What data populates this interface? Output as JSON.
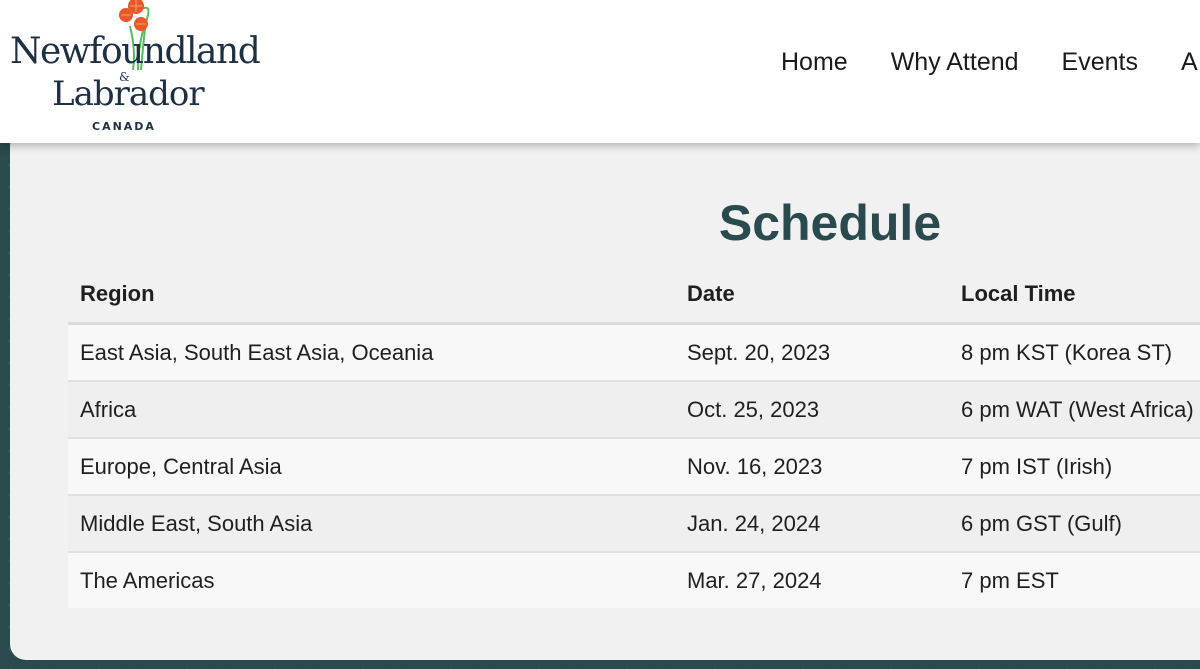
{
  "brand": {
    "logo_line1": "Newfoundland",
    "logo_amp": "&",
    "logo_line2": "Labrador",
    "logo_sub": "CANADA",
    "colors": {
      "primary": "#2b4a4d",
      "logo_text": "#1f2f42",
      "flower": "#e8582a",
      "stem": "#5cb85c"
    }
  },
  "nav": {
    "items": [
      {
        "label": "Home"
      },
      {
        "label": "Why Attend"
      },
      {
        "label": "Events"
      },
      {
        "label": "A"
      }
    ]
  },
  "main": {
    "title": "Schedule",
    "table": {
      "columns": [
        "Region",
        "Date",
        "Local Time"
      ],
      "rows": [
        {
          "region": "East Asia, South East Asia, Oceania",
          "date": "Sept. 20, 2023",
          "time": "8 pm KST (Korea ST)"
        },
        {
          "region": "Africa",
          "date": "Oct. 25, 2023",
          "time": "6 pm WAT (West Africa)"
        },
        {
          "region": "Europe, Central Asia",
          "date": "Nov. 16, 2023",
          "time": "7 pm IST (Irish)"
        },
        {
          "region": "Middle East, South Asia",
          "date": "Jan. 24, 2024",
          "time": "6 pm GST (Gulf)"
        },
        {
          "region": "The Americas",
          "date": "Mar. 27, 2024",
          "time": "7 pm EST"
        }
      ]
    }
  }
}
